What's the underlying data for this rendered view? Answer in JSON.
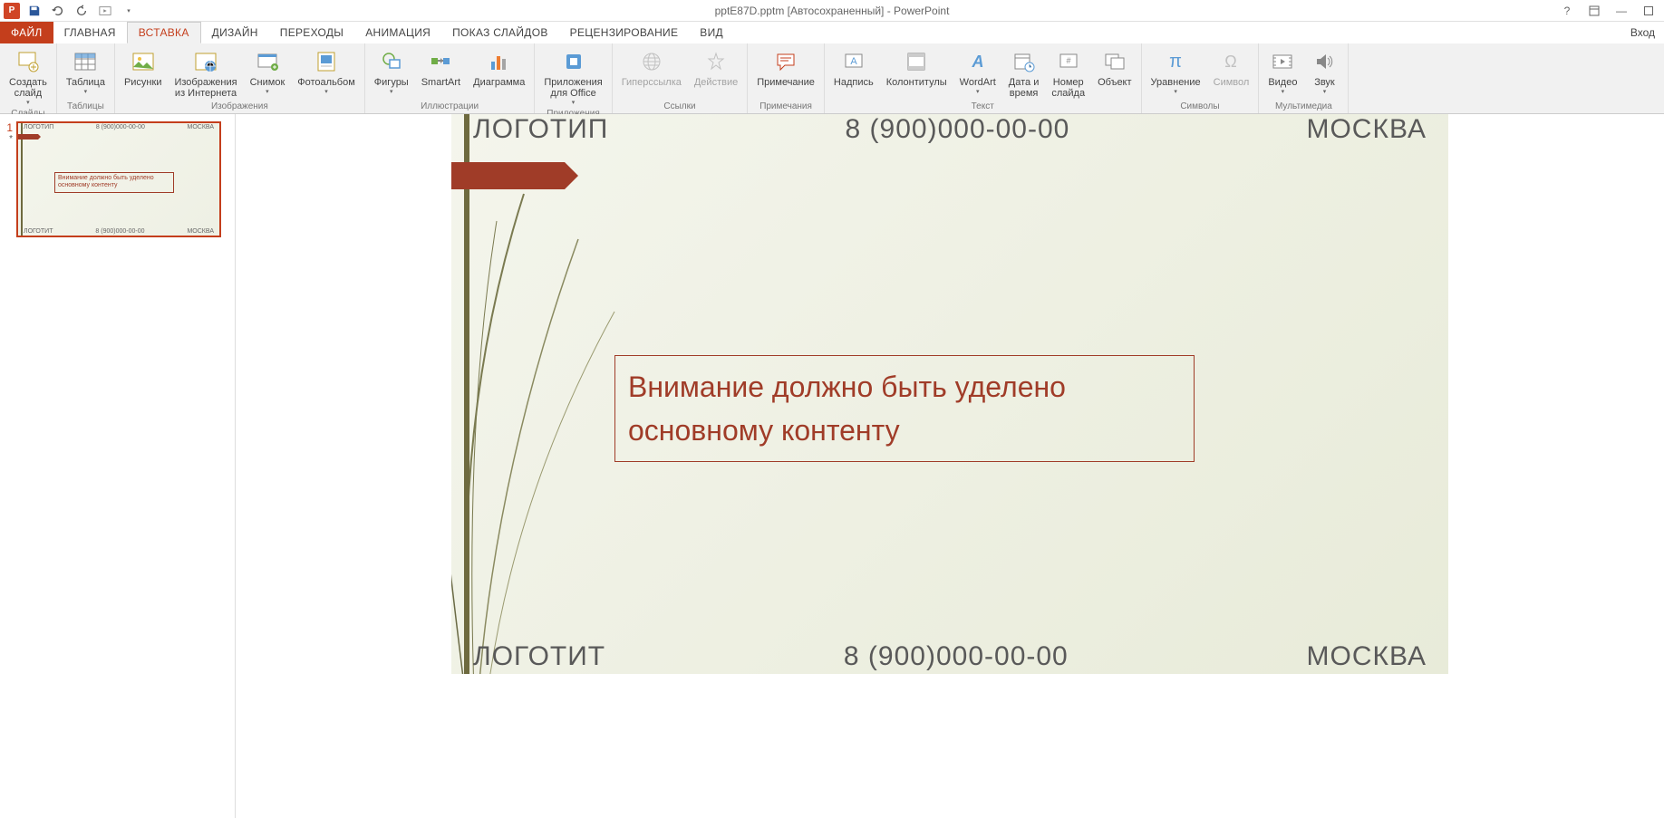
{
  "title": "pptE87D.pptm [Автосохраненный] - PowerPoint",
  "signin": "Вход",
  "tabs": {
    "file": "ФАЙЛ",
    "home": "ГЛАВНАЯ",
    "insert": "ВСТАВКА",
    "design": "ДИЗАЙН",
    "transitions": "ПЕРЕХОДЫ",
    "animations": "АНИМАЦИЯ",
    "slideshow": "ПОКАЗ СЛАЙДОВ",
    "review": "РЕЦЕНЗИРОВАНИЕ",
    "view": "ВИД"
  },
  "ribbon": {
    "slides": {
      "new_slide": "Создать\nслайд",
      "group": "Слайды"
    },
    "tables": {
      "table": "Таблица",
      "group": "Таблицы"
    },
    "images": {
      "pictures": "Рисунки",
      "online": "Изображения\nиз Интернета",
      "screenshot": "Снимок",
      "album": "Фотоальбом",
      "group": "Изображения"
    },
    "illus": {
      "shapes": "Фигуры",
      "smartart": "SmartArt",
      "chart": "Диаграмма",
      "group": "Иллюстрации"
    },
    "apps": {
      "apps": "Приложения\nдля Office",
      "group": "Приложения"
    },
    "links": {
      "hyperlink": "Гиперссылка",
      "action": "Действие",
      "group": "Ссылки"
    },
    "comments": {
      "comment": "Примечание",
      "group": "Примечания"
    },
    "text": {
      "textbox": "Надпись",
      "header": "Колонтитулы",
      "wordart": "WordArt",
      "datetime": "Дата и\nвремя",
      "slidenum": "Номер\nслайда",
      "object": "Объект",
      "group": "Текст"
    },
    "symbols": {
      "equation": "Уравнение",
      "symbol": "Символ",
      "group": "Символы"
    },
    "media": {
      "video": "Видео",
      "audio": "Звук",
      "group": "Мультимедиа"
    }
  },
  "slide": {
    "num": "1",
    "star": "*",
    "logo_top": "ЛОГОТИП",
    "phone": "8 (900)000-00-00",
    "city": "МОСКВА",
    "main_text": "Внимание должно быть уделено основному контенту",
    "logo_bottom": "ЛОГОТИТ"
  }
}
